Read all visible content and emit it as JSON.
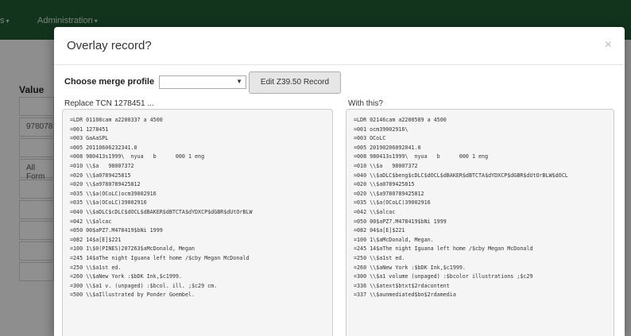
{
  "navbar": {
    "items": [
      {
        "label": "s"
      },
      {
        "label": "Administration"
      }
    ]
  },
  "background": {
    "value_label": "Value",
    "inputs": [
      "",
      "978078",
      "",
      "All Form",
      "",
      "",
      "",
      "",
      ""
    ]
  },
  "modal": {
    "title": "Overlay record?",
    "close_label": "×",
    "merge_profile_label": "Choose merge profile",
    "merge_profile_value": "",
    "edit_button_label": "Edit Z39.50 Record",
    "replace_label": "Replace TCN 1278451 ...",
    "with_label": "With this?",
    "left_record": [
      "=LDR 01108cam a2200337 a 4500",
      "=001 1278451",
      "=003 GaAaSPL",
      "=005 20110606232341.0",
      "=008 980413s1999\\  nyua   b      000 1 eng",
      "=010 \\\\$a   98007372",
      "=020 \\\\$a0789425815",
      "=020 \\\\$a9780789425812",
      "=035 \\\\$a(OCoLC)ocm39002916",
      "=035 \\\\$a(OCoLC)39002916",
      "=040 \\\\$aDLC$cDLC$dOCL$dBAKER$dBTCTA$dYDXCP$dGBR$dUtOrBLW",
      "=042 \\\\$alcac",
      "=050 00$aPZ7.M478419$bNi 1999",
      "=082 14$a[E]$221",
      "=100 1\\$0(PINES)207263$aMcDonald, Megan",
      "=245 14$aThe night Iguana left home /$cby Megan McDonald",
      "=250 \\\\$a1st ed.",
      "=260 \\\\$aNew York :$bDK Ink,$c1999.",
      "=300 \\\\$a1 v. (unpaged) :$bcol. ill. ;$c29 cm.",
      "=500 \\\\$aIllustrated by Ponder Goembel."
    ],
    "right_record": [
      "=LDR 02146cam a2200589 a 4500",
      "=001 ocm39002916\\",
      "=003 OCoLC",
      "=005 20190206092041.0",
      "=008 980413s1999\\  nyua   b      000 1 eng",
      "=010 \\\\$a   98007372",
      "=040 \\\\$aDLC$beng$cDLC$dOCL$dBAKER$dBTCTA$dYDXCP$dGBR$dUtOrBLW$dOCL",
      "=020 \\\\$a0789425815",
      "=020 \\\\$a9780789425812",
      "=035 \\\\$a(OCoLC)39002916",
      "=042 \\\\$alcac",
      "=050 00$aPZ7.M478419$bNi 1999",
      "=082 04$a[E]$221",
      "=100 1\\$aMcDonald, Megan.",
      "=245 14$aThe night Iguana left home /$cby Megan McDonald",
      "=250 \\\\$a1st ed.",
      "=260 \\\\$aNew York :$bDK Ink,$c1999.",
      "=300 \\\\$a1 volume (unpaged) :$bcolor illustrations ;$c29",
      "=336 \\\\$atext$btxt$2rdacontent",
      "=337 \\\\$aunmediated$bn$2rdamedia"
    ]
  }
}
